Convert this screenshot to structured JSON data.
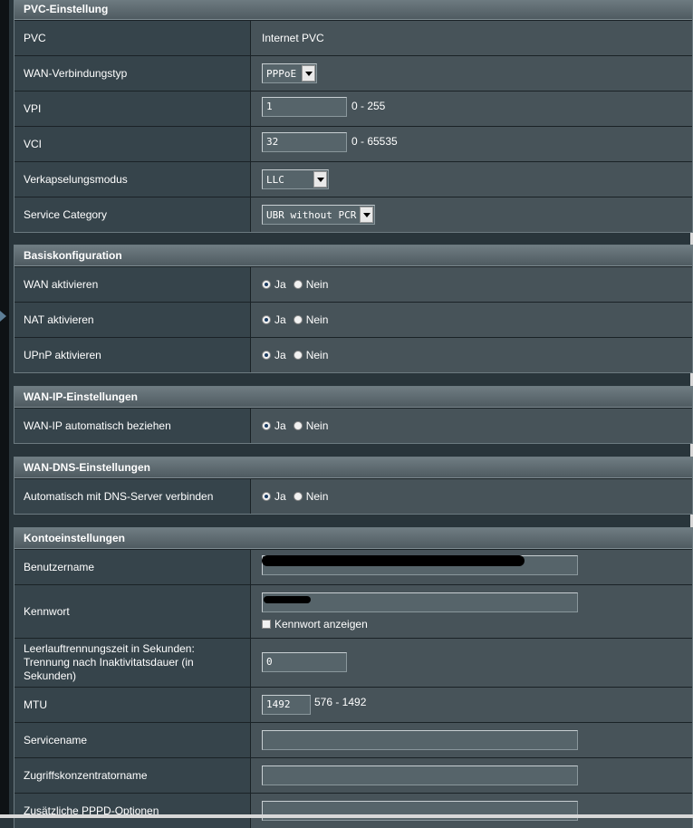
{
  "pvc": {
    "title": "PVC-Einstellung",
    "pvc_label": "PVC",
    "pvc_value": "Internet PVC",
    "wan_type_label": "WAN-Verbindungstyp",
    "wan_type_value": "PPPoE",
    "vpi_label": "VPI",
    "vpi_value": "1",
    "vpi_range": "0 - 255",
    "vci_label": "VCI",
    "vci_value": "32",
    "vci_range": "0 - 65535",
    "encap_label": "Verkapselungsmodus",
    "encap_value": "LLC",
    "service_cat_label": "Service Category",
    "service_cat_value": "UBR without PCR"
  },
  "basis": {
    "title": "Basiskonfiguration",
    "wan_label": "WAN aktivieren",
    "nat_label": "NAT aktivieren",
    "upnp_label": "UPnP aktivieren"
  },
  "radio": {
    "yes": "Ja",
    "no": "Nein"
  },
  "wanip": {
    "title": "WAN-IP-Einstellungen",
    "auto_label": "WAN-IP automatisch beziehen"
  },
  "wandns": {
    "title": "WAN-DNS-Einstellungen",
    "auto_label": "Automatisch mit DNS-Server verbinden"
  },
  "konto": {
    "title": "Kontoeinstellungen",
    "user_label": "Benutzername",
    "pass_label": "Kennwort",
    "show_pass_label": "Kennwort anzeigen",
    "idle_label": "Leerlauftrennungszeit in Sekunden: Trennung nach Inaktivitatsdauer (in Sekunden)",
    "idle_value": "0",
    "mtu_label": "MTU",
    "mtu_value": "1492",
    "mtu_range": "576 - 1492",
    "service_label": "Servicename",
    "ac_label": "Zugriffskonzentratorname",
    "pppd_label": "Zusätzliche PPPD-Optionen"
  }
}
